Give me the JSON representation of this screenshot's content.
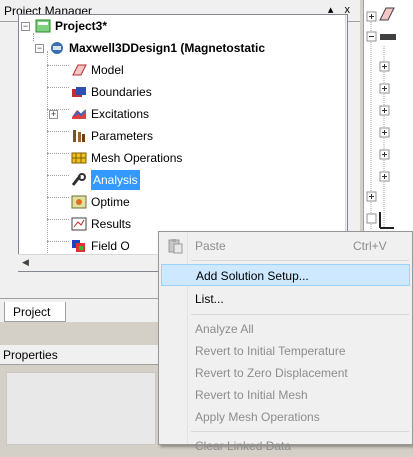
{
  "project_manager": {
    "title": "Project Manager",
    "title_buttons": "▴ x",
    "tree": {
      "project": "Project3*",
      "design": "Maxwell3DDesign1 (Magnetostatic",
      "items": [
        "Model",
        "Boundaries",
        "Excitations",
        "Parameters",
        "Mesh Operations",
        "Analysis",
        "Optime",
        "Results",
        "Field O"
      ]
    },
    "tab_label": "Project"
  },
  "properties": {
    "title": "Properties"
  },
  "context_menu": {
    "paste": {
      "label": "Paste",
      "shortcut": "Ctrl+V"
    },
    "add_solution_setup": "Add Solution Setup...",
    "list": "List...",
    "analyze_all": "Analyze All",
    "revert_temperature": "Revert to Initial Temperature",
    "revert_displacement": "Revert to Zero Displacement",
    "revert_mesh": "Revert to Initial Mesh",
    "apply_mesh_ops": "Apply Mesh Operations",
    "clear_linked": "Clear Linked Data"
  },
  "colors": {
    "selection": "#3399ff",
    "menu_highlight": "#cde8ff",
    "disabled_text": "#8d8d8d"
  }
}
